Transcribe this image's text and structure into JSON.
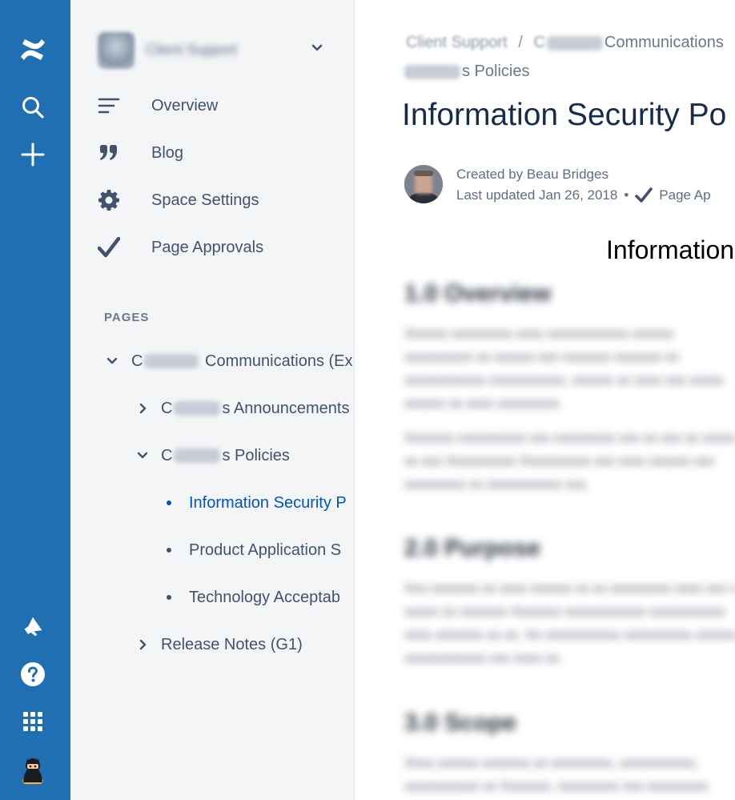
{
  "global_nav": {
    "icons": [
      "confluence-logo-icon",
      "search-icon",
      "create-plus-icon",
      "notifications-megaphone-icon",
      "help-icon",
      "app-switcher-icon",
      "user-avatar-icon"
    ]
  },
  "sidebar": {
    "space_name": "Client Support",
    "nav_items": [
      {
        "label": "Overview",
        "icon": "overview-lines-icon"
      },
      {
        "label": "Blog",
        "icon": "quote-icon"
      },
      {
        "label": "Space Settings",
        "icon": "gear-icon"
      },
      {
        "label": "Page Approvals",
        "icon": "checkmark-icon"
      }
    ],
    "pages_label": "PAGES",
    "tree": {
      "root": {
        "prefix": "C",
        "suffix": "Communications (Ex"
      },
      "announcements": {
        "prefix": "C",
        "suffix": "s Announcements"
      },
      "policies": {
        "prefix": "C",
        "suffix": "s Policies"
      },
      "child1": "Information Security P",
      "child2": "Product Application S",
      "child3": "Technology Acceptab",
      "release_notes": "Release Notes (G1)"
    }
  },
  "main": {
    "breadcrumb": {
      "item1": "Client Support",
      "sep1": "/",
      "item2_prefix": "C",
      "item2_suffix": "Communications",
      "item3_suffix": "s Policies"
    },
    "title": "Information Security Po",
    "byline": {
      "created_by": "Created by Beau Bridges",
      "last_updated": "Last updated Jan 26, 2018",
      "bullet": "•",
      "approval": "Page Ap"
    },
    "doc_heading": "Information",
    "colors": {
      "global_nav_bg": "#1f6fb2",
      "sidebar_bg": "#f4f5f7",
      "active_link": "#0052cc",
      "text": "#42526e"
    }
  }
}
